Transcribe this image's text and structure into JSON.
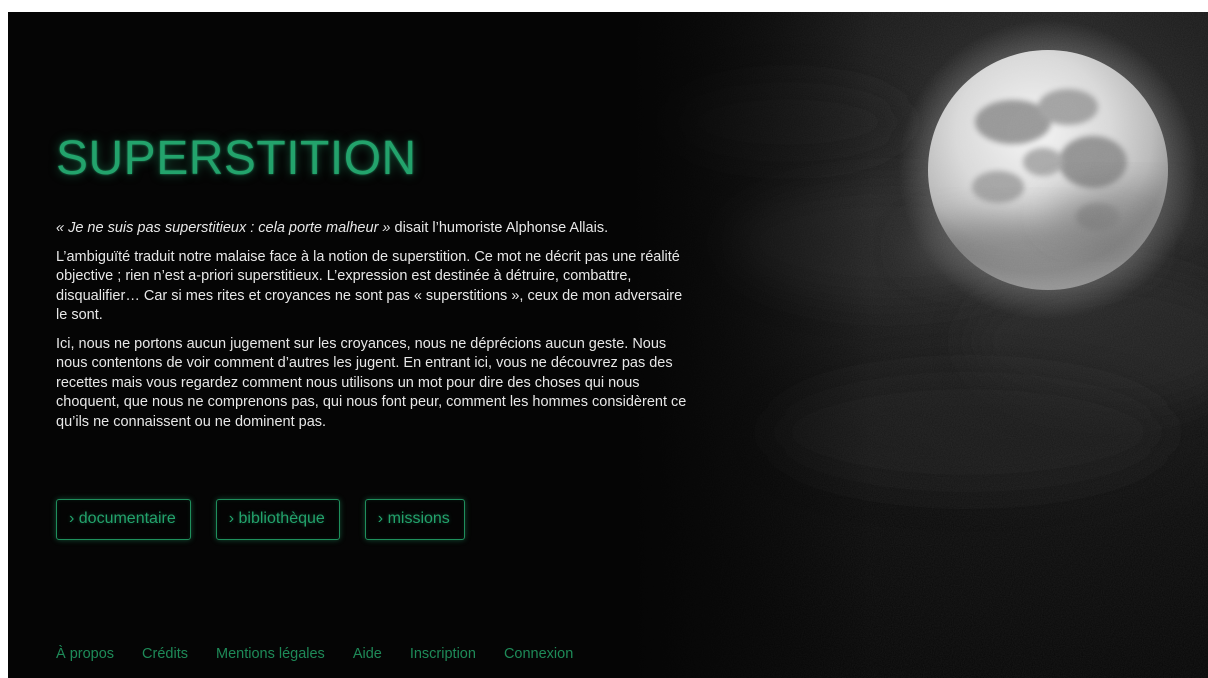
{
  "colors": {
    "accent": "#23a36c",
    "footer_link": "#1e8a58",
    "background": "#050505",
    "text": "#e8e8e8"
  },
  "hero": {
    "title": "SUPERSTITION",
    "quote_italic": "« Je ne suis pas superstitieux : cela porte malheur »",
    "quote_rest": " disait l’humoriste Alphonse Allais.",
    "paragraph_2": "L’ambiguïté traduit notre malaise face à la notion de superstition. Ce mot ne décrit pas une réalité objective ; rien n’est a-priori superstitieux. L’expression est destinée à détruire, combattre, disqualifier… Car si mes rites et croyances ne sont pas « superstitions », ceux de mon adversaire le sont.",
    "paragraph_3": "Ici, nous ne portons aucun jugement sur les croyances, nous ne déprécions aucun geste. Nous nous contentons de voir comment d’autres les jugent. En entrant ici, vous ne découvrez pas des recettes mais vous regardez comment nous utilisons un mot pour dire des choses qui nous choquent, que nous ne comprenons pas, qui nous font peur, comment les hommes considèrent ce qu’ils ne connaissent ou ne dominent pas."
  },
  "buttons": {
    "documentaire": "› documentaire",
    "bibliotheque": "› bibliothèque",
    "missions": "› missions"
  },
  "footer": {
    "a_propos": "À propos",
    "credits": "Crédits",
    "mentions": "Mentions légales",
    "aide": "Aide",
    "inscription": "Inscription",
    "connexion": "Connexion"
  },
  "background_image": "full-moon-night-sky-with-clouds"
}
